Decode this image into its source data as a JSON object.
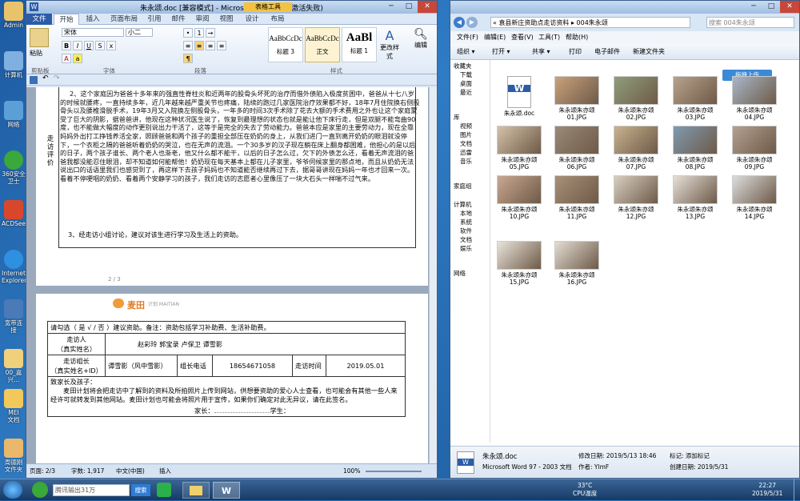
{
  "desktop_icons": [
    "Admin",
    "计算机",
    "网络",
    "360安全\n卫士",
    "ACDSee",
    "Internet\nExplorer",
    "宽带连\n接",
    "00_嘉\n兴...",
    "MEI\n文档",
    "周德刚\n文件夹"
  ],
  "word": {
    "title": "朱永颂.doc [兼容模式] - Microsoft Word(产品激活失败)",
    "context_tab": "表格工具",
    "tabs": [
      "文件",
      "开始",
      "插入",
      "页面布局",
      "引用",
      "邮件",
      "审阅",
      "视图",
      "设计",
      "布局"
    ],
    "ribbon": {
      "paste": "粘贴",
      "clipboard": "剪贴板",
      "font_name": "宋体",
      "font_size": "小二",
      "font_group": "字体",
      "paragraph_group": "段落",
      "styles_group": "样式",
      "editing": "编辑",
      "change_styles": "更改样式",
      "styles": [
        {
          "sample": "AaBbCcDc",
          "name": "标题 3"
        },
        {
          "sample": "AaBbCcDc",
          "name": "正文"
        },
        {
          "sample": "AaBl",
          "name": "标题 1"
        }
      ]
    },
    "page1": {
      "side_label": "走访评价",
      "para2": "2、这个家庭因为爸爸十多年来的强直性脊柱炎和近两年的股骨头坏死的治疗而借外债陷入极度贫困中，爸爸从十七八岁的时候就腰疼，一直持续多年，近几年越来越严重关节也疼痛，陆续的跑过几家医院治疗效果都不好，18年7月住院换右侧股骨头以及腰椎滑脱手术，19年3月又入院换左侧股骨头，一年多的时间3次手术除了花去大额的手术费用之外也让这个家庭蒙受了巨大的阴影，据爸爸讲，他现在这种状况医生说了，恢复到最理想的状态也就是能让他下床行走，但是双腿不能弯曲90度，也不能做大幅度的动作更别说出力干活了，这等于是完全的失去了劳动能力。爸爸本应是家里的主要劳动力，现在全靠妈妈外出打工挣钱养活全家，照顾爸爸和两个孩子的重担全部压在奶奶的身上，从我们进门一直到离开奶奶的眼泪就没停下，一个衣柜之隔的爸爸听着奶奶的哭泣，也在无声的流泪。一个30多岁的汉子现在躺在床上翻身都困难，他担心的是以后的日子，两个孩子谁长、两个老人也渐老，他又什么都不能干，以后的日子怎么过，欠下的外债怎么还，看着无声流泪的爸爸我都没能忍住眼泪，却不知道如何能帮他！奶奶现在每天基本上都在儿子家里，爷爷伺候家里的那点地，而且从奶奶无法说出口的话语里我们也感觉到了，再这样下去孩子妈妈也不知道能否继续再过下去，据哥哥讲现在妈妈一年也才回来一次。看着不停哽咽的奶奶、看着两个安静学习的孩子，我们走访的志愿者心里像压了一块大石头一样喘不过气来。",
      "para3": "3、经走访小组讨论，建议对该生进行学习及生活上的资助。",
      "page_marker": "2 / 3"
    },
    "page2": {
      "logo": "麦田",
      "logo_sub": "计划 MAITIAN",
      "recommend": "请勾选（ 是 √ / 否 ）建议资助。备注：资助包括学习补助费、生活补助费。",
      "visitor_label": "走访人\n（真实姓名）",
      "visitors": "赵彩玲  郭宝录  卢保卫  谭雪影",
      "leader_label": "走访组长\n（真实姓名+ID）",
      "leader": "谭雪影（风中雪影）",
      "phone_label": "组长电话",
      "phone": "18654671058",
      "time_label": "走访时间",
      "date": "2019.05.01",
      "letter_greeting": "致家长及孩子：",
      "letter_body": "麦田计划将会把走访中了解到的资料及所拍照片上传到网站，供想要资助的爱心人士查看，也可能会有其他一些人来经许可就转发到其他网站。麦田计划也可能会将照片用于宣传，如果你们确定对此无异议，请在此签名。",
      "parent": "家长：",
      "student": "学生："
    },
    "status": {
      "page": "页面: 2/3",
      "words": "字数: 1,917",
      "lang": "中文(中国)",
      "mode": "插入",
      "zoom": "100%"
    }
  },
  "explorer": {
    "path": "« 袁县新庄资助点走访资料 ▸ 004朱永颂",
    "search": "搜索 004朱永颂",
    "menu": [
      "文件(F)",
      "编辑(E)",
      "查看(V)",
      "工具(T)",
      "帮助(H)"
    ],
    "commands": [
      "组织 ▾",
      "打开 ▾",
      "共享 ▾",
      "打印",
      "电子邮件",
      "新建文件夹"
    ],
    "upload": "拖拽上传",
    "nav": [
      "收藏夹",
      "下载",
      "桌面",
      "最近",
      "库",
      "视频",
      "图片",
      "文档",
      "迅雷",
      "音乐",
      "家庭组",
      "计算机",
      "本地",
      "系统",
      "软件",
      "文档",
      "娱乐",
      "网络"
    ],
    "files": [
      {
        "name": "朱永颂.doc",
        "kind": "doc"
      },
      {
        "name": "朱永颂朱亦颂\n01.JPG"
      },
      {
        "name": "朱永颂朱亦颂\n02.JPG"
      },
      {
        "name": "朱永颂朱亦颂\n03.JPG"
      },
      {
        "name": "朱永颂朱亦颂\n04.JPG"
      },
      {
        "name": "朱永颂朱亦颂\n05.JPG"
      },
      {
        "name": "朱永颂朱亦颂\n06.JPG"
      },
      {
        "name": "朱永颂朱亦颂\n07.JPG"
      },
      {
        "name": "朱永颂朱亦颂\n08.JPG"
      },
      {
        "name": "朱永颂朱亦颂\n09.JPG"
      },
      {
        "name": "朱永颂朱亦颂\n10.JPG"
      },
      {
        "name": "朱永颂朱亦颂\n11.JPG"
      },
      {
        "name": "朱永颂朱亦颂\n12.JPG"
      },
      {
        "name": "朱永颂朱亦颂\n13.JPG"
      },
      {
        "name": "朱永颂朱亦颂\n14.JPG"
      },
      {
        "name": "朱永颂朱亦颂\n15.JPG"
      },
      {
        "name": "朱永颂朱亦颂\n16.JPG"
      }
    ],
    "details": {
      "name": "朱永颂.doc",
      "type": "Microsoft Word 97 - 2003 文档",
      "modified": "修改日期: 2019/5/13 18:46",
      "tags": "标记: 添加标记",
      "author": "作者: YlmF",
      "created": "创建日期: 2019/5/31"
    }
  },
  "taskbar": {
    "search": "腾讯输出31万",
    "search_btn": "搜索",
    "temp": "33°C",
    "cpu": "CPU温度",
    "time": "22:27",
    "date": "2019/5/31"
  }
}
